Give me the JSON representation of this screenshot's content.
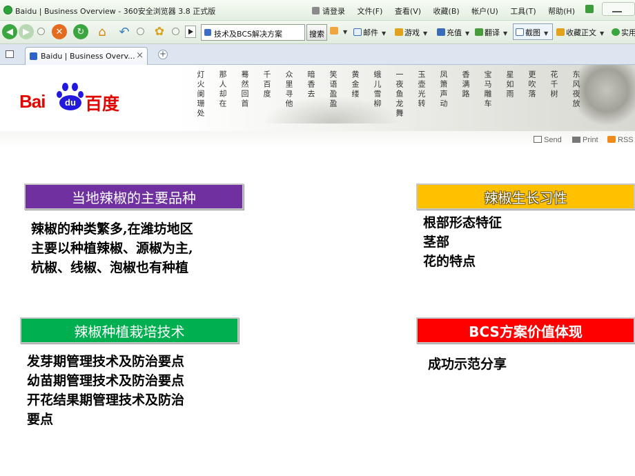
{
  "browser": {
    "window_title": "Baidu | Business Overview - 360安全浏览器 3.8 正式版",
    "menu": {
      "login": "请登录",
      "file": "文件(F)",
      "view": "查看(V)",
      "favorites": "收藏(B)",
      "account": "帐户(U)",
      "tools": "工具(T)",
      "help": "帮助(H)"
    },
    "toolbar": {
      "address_text": "技术及BCS解决方案",
      "search_label": "搜索",
      "mail": "邮件",
      "games": "游戏",
      "recharge": "充值",
      "translate": "翻译",
      "screenshot": "截图",
      "collect_text": "收藏正文",
      "practical": "实用"
    },
    "tab": {
      "title": "Baidu | Business Overv...",
      "close": "×",
      "new": "+"
    }
  },
  "header": {
    "logo_text_en": "Bai",
    "logo_text_du": "du",
    "logo_text_cn": "百度",
    "poem_columns": [
      "东风夜放",
      "花千树",
      "更吹落",
      "星如雨",
      "宝马雕车",
      "香满路",
      "凤箫声动",
      "玉壶光转",
      "一夜鱼龙舞",
      "蛾儿雪柳",
      "黄金缕",
      "笑语盈盈",
      "暗香去",
      "众里寻他",
      "千百度",
      "蓦然回首",
      "那人却在",
      "灯火阑珊处"
    ],
    "share": {
      "send": "Send",
      "print": "Print",
      "rss": "RSS"
    }
  },
  "content": {
    "box1": {
      "title": "当地辣椒的主要品种",
      "lines": [
        "辣椒的种类繁多,在潍坊地区",
        "主要以种植辣椒、源椒为主,",
        "杭椒、线椒、泡椒也有种植"
      ]
    },
    "box2": {
      "title": "辣椒生长习性",
      "lines": [
        "根部形态特征",
        "茎部",
        "花的特点"
      ]
    },
    "box3": {
      "title": "辣椒种植栽培技术",
      "lines": [
        "发芽期管理技术及防治要点",
        "幼苗期管理技术及防治要点",
        "开花结果期管理技术及防治",
        "要点"
      ]
    },
    "box4": {
      "title": "BCS方案价值体现",
      "lines": [
        "成功示范分享"
      ]
    }
  },
  "colors": {
    "purple": "#7030a0",
    "yellow": "#ffc000",
    "green": "#00b050",
    "red": "#ff0000",
    "baidu_red": "#e10602",
    "baidu_blue": "#2319dc"
  }
}
